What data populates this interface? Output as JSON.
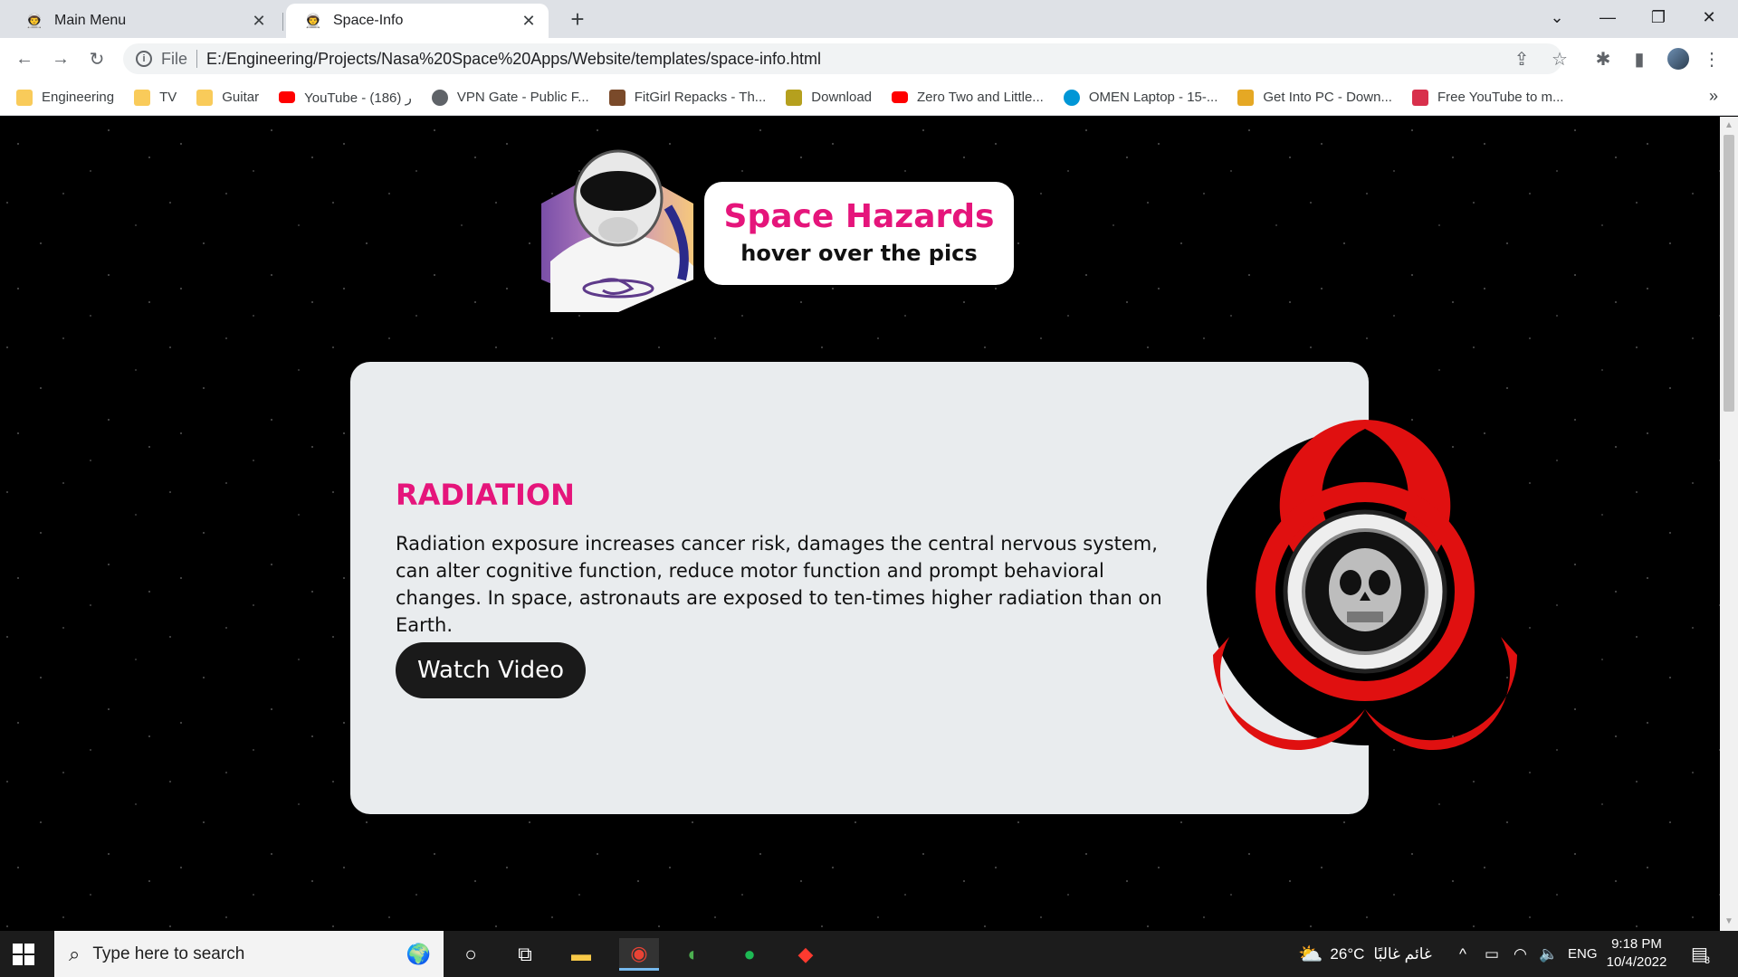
{
  "browser": {
    "tabs": [
      {
        "title": "Main Menu",
        "active": false
      },
      {
        "title": "Space-Info",
        "active": true
      }
    ],
    "address": {
      "scheme": "File",
      "url": "E:/Engineering/Projects/Nasa%20Space%20Apps/Website/templates/space-info.html"
    },
    "bookmarks": [
      {
        "label": "Engineering",
        "icon": "folder-icon",
        "color": "#f9cb5a"
      },
      {
        "label": "TV",
        "icon": "folder-icon",
        "color": "#f9cb5a"
      },
      {
        "label": "Guitar",
        "icon": "folder-icon",
        "color": "#f9cb5a"
      },
      {
        "label": "YouTube - ر (186)",
        "icon": "youtube-icon",
        "color": "#ff0000"
      },
      {
        "label": "VPN Gate - Public F...",
        "icon": "globe-icon",
        "color": "#5f6368"
      },
      {
        "label": "FitGirl Repacks - Th...",
        "icon": "site-icon",
        "color": "#7a4a2a"
      },
      {
        "label": "Download",
        "icon": "download-icon",
        "color": "#b5a01e"
      },
      {
        "label": "Zero Two and Little...",
        "icon": "youtube-icon",
        "color": "#ff0000"
      },
      {
        "label": "OMEN Laptop - 15-...",
        "icon": "hp-icon",
        "color": "#0096d6"
      },
      {
        "label": "Get Into PC - Down...",
        "icon": "g-icon",
        "color": "#e5a824"
      },
      {
        "label": "Free YouTube to m...",
        "icon": "link-icon",
        "color": "#d8304c"
      }
    ]
  },
  "page": {
    "header": {
      "title": "Space Hazards",
      "subtitle": "hover over the pics"
    },
    "card": {
      "title": "RADIATION",
      "body": "Radiation exposure increases cancer risk, damages the central nervous system, can alter cognitive function, reduce motor function and prompt behavioral changes. In space, astronauts are exposed to ten-times higher radiation than on Earth.",
      "button": "Watch Video"
    },
    "colors": {
      "accent": "#e5157b",
      "card_bg": "#e9ecee",
      "button_bg": "#1a1a1a",
      "hazard_red": "#e01010"
    }
  },
  "taskbar": {
    "search_placeholder": "Type here to search",
    "weather": "26°C",
    "weather_desc": "غائم غالبًا",
    "language": "ENG",
    "time": "9:18 PM",
    "date": "10/4/2022",
    "notifications": "3"
  }
}
